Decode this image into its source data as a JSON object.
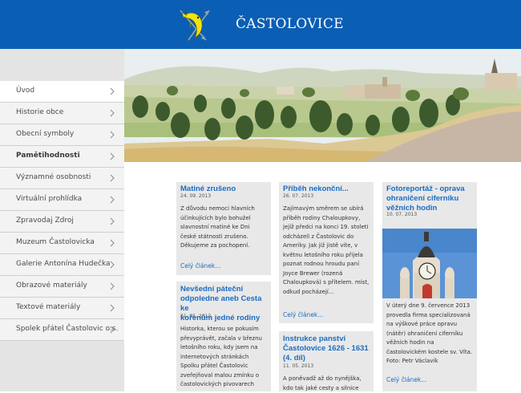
{
  "site": {
    "title": "ČASTOLOVICE"
  },
  "sidebar": {
    "items": [
      {
        "label": "Úvod"
      },
      {
        "label": "Historie obce"
      },
      {
        "label": "Obecní symboly"
      },
      {
        "label": "Pamětihodnosti"
      },
      {
        "label": "Významné osobnosti"
      },
      {
        "label": "Virtuální prohlídka"
      },
      {
        "label": "Zpravodaj Zdroj"
      },
      {
        "label": "Muzeum Častolovicka"
      },
      {
        "label": "Galerie Antonína Hudečka"
      },
      {
        "label": "Obrazové materiály"
      },
      {
        "label": "Textové materiály"
      },
      {
        "label": "Spolek přátel Častolovic o.s."
      }
    ]
  },
  "articles": {
    "col1a": {
      "title": "Matiné zrušeno",
      "date": "24. 09. 2013",
      "lines": [
        "Z důvodu nemoci hlavních",
        "účinkujících bylo bohužel",
        "slavnostní matiné ke Dni",
        "české státnosti zrušeno.",
        "Děkujeme za pochopení."
      ],
      "more": "Celý článek..."
    },
    "col1b": {
      "title_lines": [
        "Nevšední páteční",
        "odpoledne aneb Cesta ke",
        "kořenům jedné rodiny"
      ],
      "date": "21. 05. 2013",
      "lines": [
        "Historka, kterou se pokusím",
        "převyprávět, začala v březnu",
        "letošního roku, kdy jsem na",
        "internetových stránkách",
        "Spolku přátel Častolovic",
        "zveřejňoval malou zmínku o",
        "častolovických pivovarech"
      ]
    },
    "col2a": {
      "title": "Příběh nekonční...",
      "date": "26. 07. 2013",
      "lines": [
        "Zajímavým směrem se ubírá",
        "příběh rodiny Chaloupkovy,",
        "jejíž předci na konci 19. století",
        "odcházeli z Častolovic do",
        "Ameriky. Jak již jistě víte, v",
        "květnu letošního roku přijela",
        "poznat rodnou hroudu paní",
        "Joyce Brewer (rozená",
        "Chaloupková) s přítelem. míst,",
        "odkud pocházejí..."
      ],
      "more": "Celý článek..."
    },
    "col2b": {
      "title_lines": [
        "Instrukce panství",
        "Častolovice 1626 - 1631",
        "(4. díl)"
      ],
      "date": "11. 05. 2013",
      "lines": [
        "A poněvadž až do nynějška,",
        "kdo tak jaké cesty a silnice"
      ]
    },
    "col3": {
      "title_lines": [
        "Fotoreportáž - oprava",
        "ohraničení ciferníku",
        "věžních hodin"
      ],
      "date": "10. 07. 2013",
      "lines": [
        "V úterý dne 9. července 2013",
        "provedla firma specializovaná",
        "na výškové práce opravu",
        "(nátěr) ohraničení ciferníku",
        "věžních hodin na",
        "častolovickém kostele sv. Víta.",
        "Foto: Petr Václavík"
      ],
      "more": "Celý článek..."
    }
  },
  "colors": {
    "header": "#0a5fb4",
    "link": "#1a6cc4",
    "card": "#e8e8e8",
    "sidebar": "#e4e4e4"
  },
  "icons": {
    "logo": "fish-arrow-crest-icon",
    "chevron": "chevron-right-icon"
  }
}
